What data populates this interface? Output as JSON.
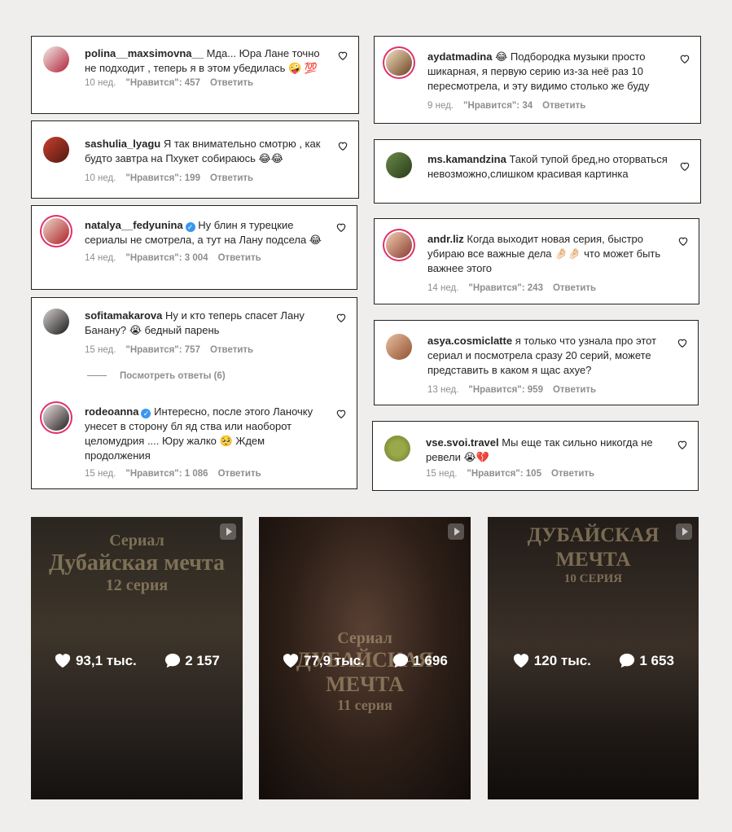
{
  "comments_left": [
    {
      "user": "polina__maxsimovna__",
      "verified": false,
      "text": "Мда... Юра Лане точно не подходит , теперь я в этом убедилась 🤪 💯",
      "time": "10 нед.",
      "likes": "\"Нравится\": 457",
      "reply": "Ответить"
    },
    {
      "user": "sashulia_lyagu",
      "verified": false,
      "text": "Я так внимательно смотрю , как будто завтра на Пхукет собираюсь 😂😂",
      "time": "10 нед.",
      "likes": "\"Нравится\": 199",
      "reply": "Ответить"
    },
    {
      "user": "natalya__fedyunina",
      "verified": true,
      "text": "Ну блин я турецкие сериалы не смотрела, а тут на Лану подсела 😂",
      "time": "14 нед.",
      "likes": "\"Нравится\": 3 004",
      "reply": "Ответить"
    },
    {
      "user": "sofitamakarova",
      "verified": false,
      "text": "Ну и кто теперь спасет Лану Банану? 😭 бедный парень",
      "time": "15 нед.",
      "likes": "\"Нравится\": 757",
      "reply": "Ответить",
      "view_replies": "Посмотреть ответы (6)"
    },
    {
      "user": "rodeoanna",
      "verified": true,
      "text": "Интересно, после этого Ланочку унесет в сторону бл яд ства или наоборот целомудрия .... Юру жалко 🥺 Ждем продолжения",
      "time": "15 нед.",
      "likes": "\"Нравится\": 1 086",
      "reply": "Ответить"
    }
  ],
  "comments_right": [
    {
      "user": "aydatmadina",
      "verified": false,
      "text": "😂 Подбородка музыки просто шикарная, я первую серию из-за неё раз 10 пересмотрела, и эту видимо столько же буду",
      "time": "9 нед.",
      "likes": "\"Нравится\": 34",
      "reply": "Ответить"
    },
    {
      "user": "ms.kamandzina",
      "verified": false,
      "text": "Такой тупой бред,но оторваться невозможно,слишком красивая картинка",
      "time": "",
      "likes": "",
      "reply": ""
    },
    {
      "user": "andr.liz",
      "verified": false,
      "text": "Когда выходит новая серия, быстро убираю все важные дела 🤌🏻🤌🏻 что может быть важнее этого",
      "time": "14 нед.",
      "likes": "\"Нравится\": 243",
      "reply": "Ответить"
    },
    {
      "user": "asya.cosmiclatte",
      "verified": false,
      "text": "я только что узнала про этот сериал и посмотрела сразу 20 серий, можете представить в каком я щас ахуе?",
      "time": "13 нед.",
      "likes": "\"Нравится\": 959",
      "reply": "Ответить"
    },
    {
      "user": "vse.svoi.travel",
      "verified": false,
      "text": "Мы еще так сильно никогда не ревели 😭💔",
      "time": "15 нед.",
      "likes": "\"Нравится\": 105",
      "reply": "Ответить"
    }
  ],
  "reels": [
    {
      "title_line1": "Сериал",
      "title_line2": "Дубайская мечта",
      "title_line3": "12 серия",
      "likes": "93,1 тыс.",
      "comments": "2 157",
      "colors": [
        "#3a3128",
        "#1c1814"
      ]
    },
    {
      "title_line1": "Сериал",
      "title_line2": "ДУБАЙСКАЯ МЕЧТА",
      "title_line3": "11 серия",
      "likes": "77,9 тыс.",
      "comments": "1 696",
      "colors": [
        "#3b2a22",
        "#1a120e"
      ]
    },
    {
      "title_line1": "ДУБАЙСКАЯ МЕЧТА",
      "title_line2": "10 СЕРИЯ",
      "title_line3": "",
      "likes": "120 тыс.",
      "comments": "1 653",
      "colors": [
        "#2e2620",
        "#141110"
      ]
    }
  ],
  "avatar_colors": [
    "#a0282e",
    "#b0503a",
    "#8a4a3a",
    "#222",
    "#303030",
    "#c8a080",
    "#5a6a3a",
    "#b07050",
    "#c89070",
    "#6a7a2a"
  ]
}
